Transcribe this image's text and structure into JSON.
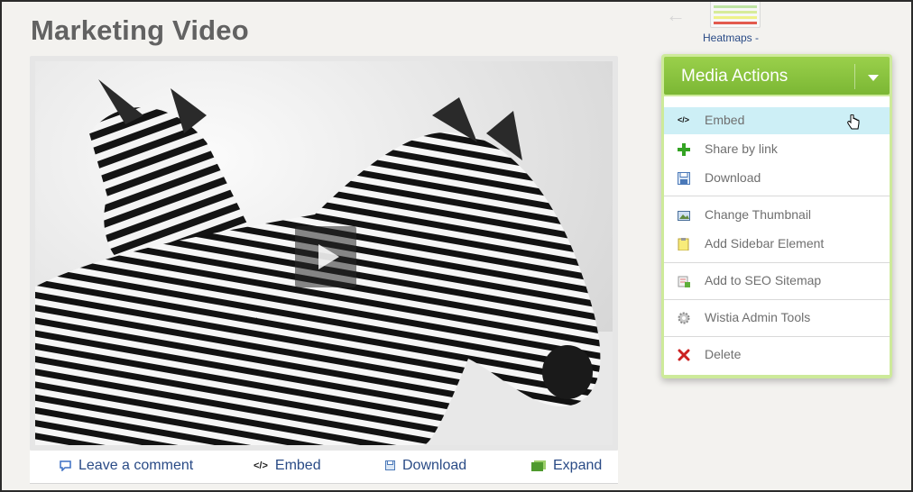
{
  "page": {
    "title": "Marketing Video"
  },
  "heatmaps": {
    "label": "Heatmaps -"
  },
  "video": {
    "play_icon": "play-icon"
  },
  "video_actions": [
    {
      "label": "Leave a comment",
      "icon": "comment-icon"
    },
    {
      "label": "Embed",
      "icon": "embed-code-icon"
    },
    {
      "label": "Download",
      "icon": "disk-icon"
    },
    {
      "label": "Expand",
      "icon": "expand-icon"
    }
  ],
  "media_actions": {
    "title": "Media Actions",
    "items": [
      {
        "label": "Embed",
        "icon": "embed-code-icon",
        "highlighted": true
      },
      {
        "label": "Share by link",
        "icon": "plus-icon"
      },
      {
        "label": "Download",
        "icon": "disk-icon"
      },
      {
        "label": "Change Thumbnail",
        "icon": "thumbnail-icon"
      },
      {
        "label": "Add Sidebar Element",
        "icon": "note-icon"
      },
      {
        "label": "Add to SEO Sitemap",
        "icon": "sitemap-icon"
      },
      {
        "label": "Wistia Admin Tools",
        "icon": "gear-icon"
      },
      {
        "label": "Delete",
        "icon": "delete-icon"
      }
    ]
  },
  "colors": {
    "accent_green": "#8cc63f",
    "link_blue": "#2a4b86",
    "hover_cyan": "#cdeff6",
    "delete_red": "#cc2222"
  }
}
